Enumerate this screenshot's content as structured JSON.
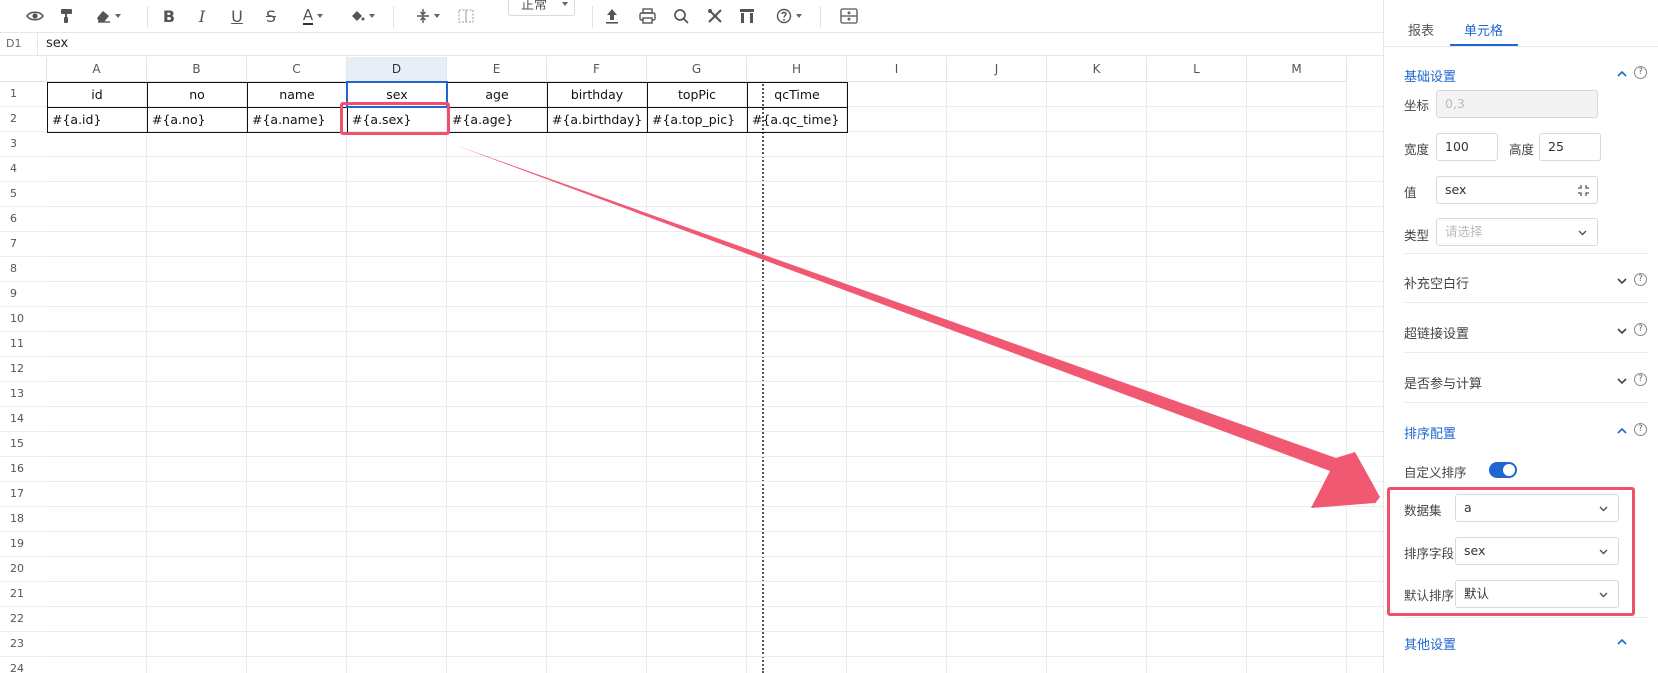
{
  "toolbar": {
    "font_size_value": "正常",
    "icons": [
      "eye-icon",
      "format-painter-icon",
      "eraser-icon",
      "bold-icon",
      "italic-icon",
      "underline-icon",
      "strikethrough-icon",
      "font-color-icon",
      "fill-color-icon",
      "vertical-align-icon",
      "merge-cells-icon",
      "upload-icon",
      "print-icon",
      "search-icon",
      "tools-icon",
      "chart-icon",
      "help-icon",
      "freeze-icon"
    ],
    "bold": "B",
    "italic": "I",
    "underline": "U",
    "strike": "S",
    "font_color": "A"
  },
  "formula_bar": {
    "cell_ref": "D1",
    "value": "sex"
  },
  "grid": {
    "columns": [
      "A",
      "B",
      "C",
      "D",
      "E",
      "F",
      "G",
      "H",
      "I",
      "J",
      "K",
      "L",
      "M"
    ],
    "selected_column": "D",
    "rows": [
      "1",
      "2",
      "3",
      "4",
      "5",
      "6",
      "7",
      "8",
      "9",
      "10",
      "11",
      "12",
      "13",
      "14",
      "15",
      "16",
      "17",
      "18",
      "19",
      "20",
      "21",
      "22",
      "23",
      "24"
    ],
    "header_row": [
      "id",
      "no",
      "name",
      "sex",
      "age",
      "birthday",
      "topPic",
      "qcTime"
    ],
    "data_row": [
      "#{a.id}",
      "#{a.no}",
      "#{a.name}",
      "#{a.sex}",
      "#{a.age}",
      "#{a.birthday}",
      "#{a.top_pic}",
      "#{a.qc_time}"
    ]
  },
  "panel": {
    "tabs": [
      "报表",
      "单元格"
    ],
    "active_tab": "单元格",
    "basic": {
      "title": "基础设置",
      "coord_label": "坐标",
      "coord_value": "0,3",
      "width_label": "宽度",
      "width_value": "100",
      "height_label": "高度",
      "height_value": "25",
      "value_label": "值",
      "value_value": "sex",
      "type_label": "类型",
      "type_placeholder": "请选择"
    },
    "sections": {
      "fill_blank": "补充空白行",
      "hyperlink": "超链接设置",
      "calc": "是否参与计算",
      "sort": "排序配置",
      "other": "其他设置"
    },
    "sort": {
      "custom_label": "自定义排序",
      "custom_enabled": true,
      "dataset_label": "数据集",
      "dataset_value": "a",
      "field_label": "排序字段",
      "field_value": "sex",
      "default_label": "默认排序",
      "default_value": "默认"
    },
    "help_glyph": "?"
  },
  "colors": {
    "accent": "#1f66d1",
    "annotation": "#f0506a"
  }
}
